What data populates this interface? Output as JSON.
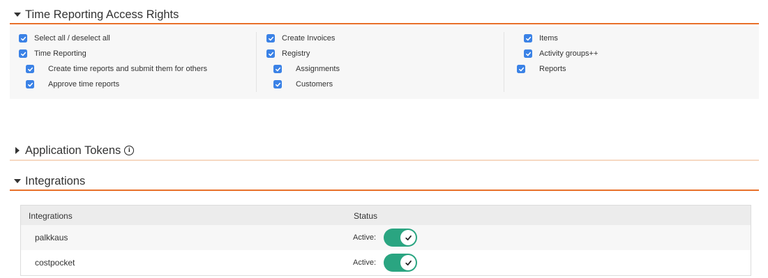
{
  "sections": {
    "access_rights": {
      "title": "Time Reporting Access Rights",
      "expanded": true,
      "columns": [
        [
          {
            "label": "Select all / deselect all",
            "checked": true,
            "indent": false
          },
          {
            "label": "Time Reporting",
            "checked": true,
            "indent": false
          },
          {
            "label": "Create time reports and submit them for others",
            "checked": true,
            "indent": true
          },
          {
            "label": "Approve time reports",
            "checked": true,
            "indent": true
          }
        ],
        [
          {
            "label": "Create Invoices",
            "checked": true,
            "indent": false
          },
          {
            "label": "Registry",
            "checked": true,
            "indent": false
          },
          {
            "label": "Assignments",
            "checked": true,
            "indent": true
          },
          {
            "label": "Customers",
            "checked": true,
            "indent": true
          }
        ],
        [
          {
            "label": "Items",
            "checked": true,
            "indent": true
          },
          {
            "label": "Activity groups++",
            "checked": true,
            "indent": true
          },
          {
            "label": "Reports",
            "checked": true,
            "indent": false
          }
        ]
      ]
    },
    "application_tokens": {
      "title": "Application Tokens",
      "expanded": false
    },
    "integrations": {
      "title": "Integrations",
      "expanded": true,
      "columns": {
        "name": "Integrations",
        "status": "Status"
      },
      "rows": [
        {
          "name": "palkkaus",
          "status_label": "Active:",
          "active": true
        },
        {
          "name": "costpocket",
          "status_label": "Active:",
          "active": true
        }
      ]
    }
  },
  "colors": {
    "accent": "#e8702a",
    "checkbox": "#3b82e6",
    "toggle_on": "#2aa581"
  }
}
